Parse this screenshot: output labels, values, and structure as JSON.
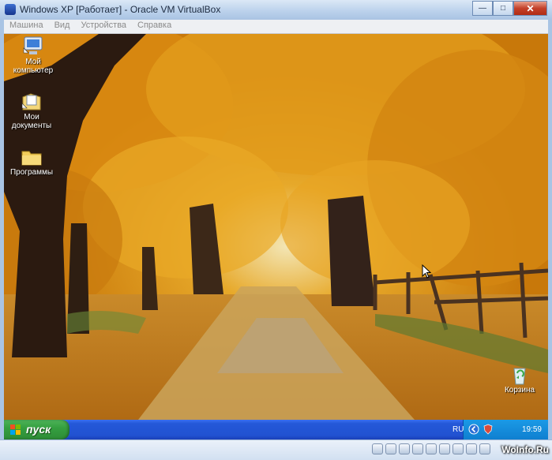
{
  "window": {
    "title": "Windows XP [Работает] - Oracle VM VirtualBox",
    "minimize_glyph": "—",
    "maximize_glyph": "□",
    "close_glyph": "✕"
  },
  "menu": {
    "items": [
      "Машина",
      "Вид",
      "Устройства",
      "Справка"
    ]
  },
  "desktop": {
    "icons": [
      {
        "label": "Мой компьютер",
        "icon": "computer-icon"
      },
      {
        "label": "Мои документы",
        "icon": "documents-icon"
      },
      {
        "label": "Программы",
        "icon": "folder-icon"
      },
      {
        "label": "Корзина",
        "icon": "recycle-bin-icon"
      }
    ]
  },
  "taskbar": {
    "start_label": "пуск",
    "language": "RU",
    "clock": "19:59"
  },
  "statusbar": {
    "icons": [
      "hard-disk-icon",
      "optical-drive-icon",
      "usb-icon",
      "shared-folders-icon",
      "display-icon",
      "network-icon",
      "record-icon",
      "host-key-icon",
      "mouse-integration-icon"
    ],
    "watermark": "WoInfo.Ru"
  }
}
